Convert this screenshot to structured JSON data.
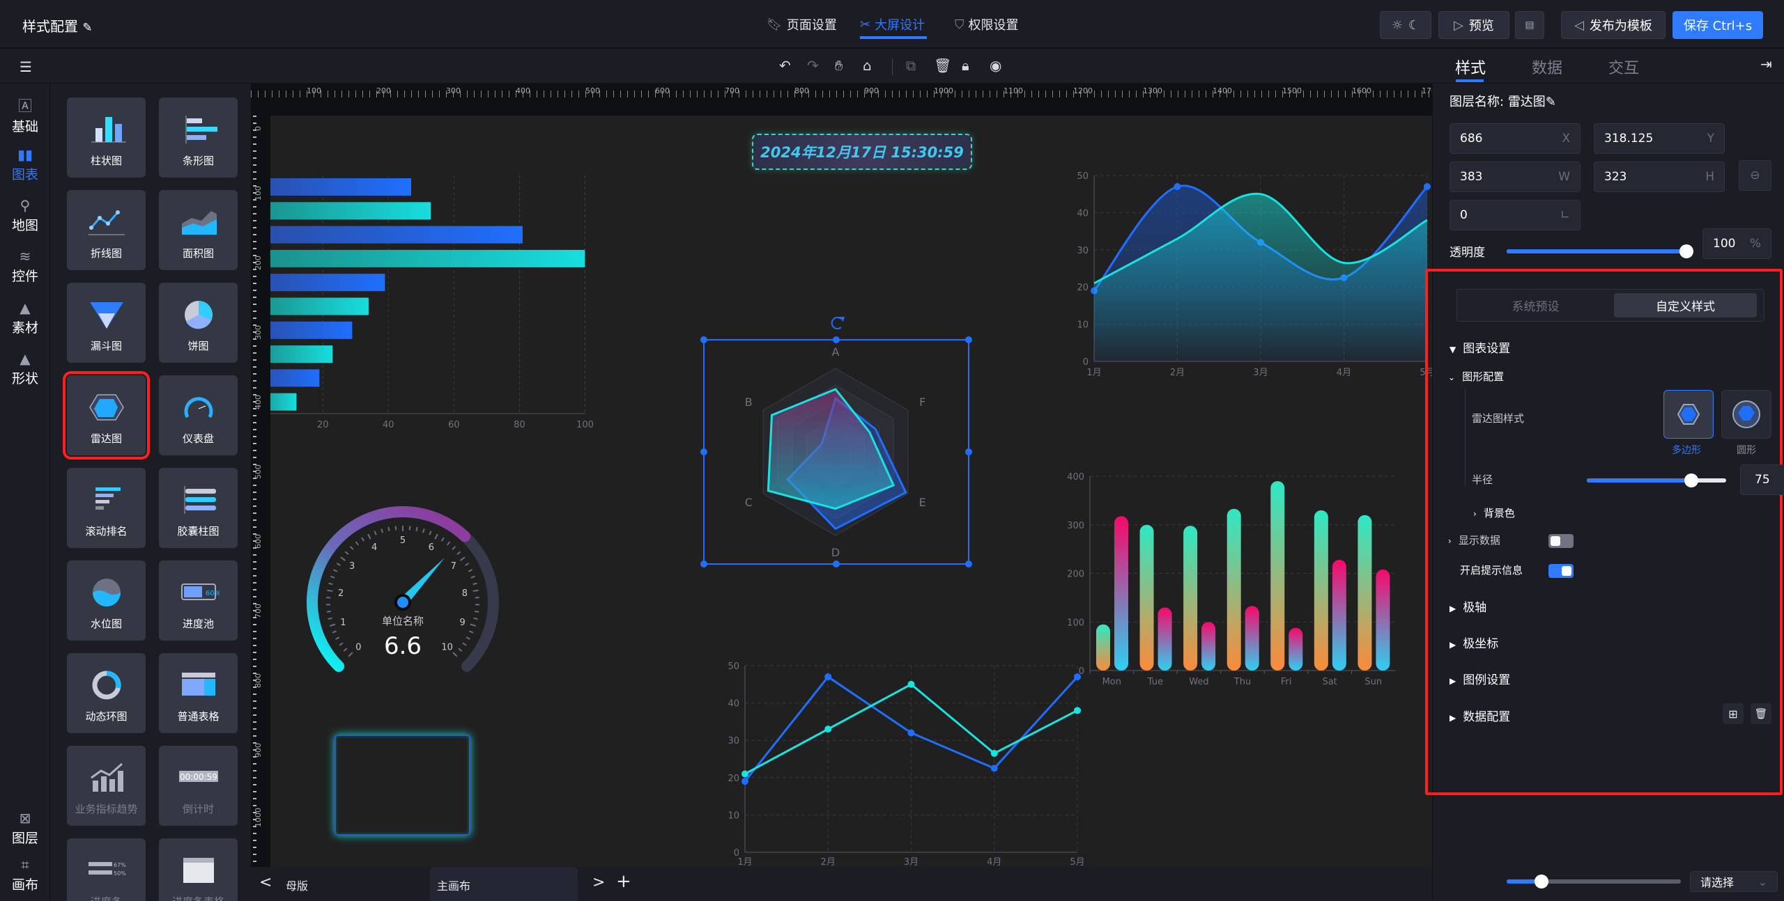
{
  "header": {
    "title": "样式配置",
    "edit_icon": "pencil-icon",
    "tabs": [
      {
        "label": "页面设置",
        "icon": "bookmark-icon"
      },
      {
        "label": "大屏设计",
        "icon": "design-icon",
        "active": true
      },
      {
        "label": "权限设置",
        "icon": "shield-icon"
      }
    ],
    "preview": "预览",
    "publish": "发布为模板",
    "save": "保存 Ctrl+s"
  },
  "toolbar": {
    "icons": [
      "undo-icon",
      "redo-icon",
      "hand-icon",
      "clear-icon",
      "copy-icon",
      "delete-icon",
      "lock-icon",
      "eye-icon"
    ]
  },
  "rail": {
    "items": [
      {
        "label": "基础",
        "icon": "text-box-icon"
      },
      {
        "label": "图表",
        "icon": "bar-chart-icon",
        "active": true
      },
      {
        "label": "地图",
        "icon": "map-pin-icon"
      },
      {
        "label": "控件",
        "icon": "layers-icon"
      },
      {
        "label": "素材",
        "icon": "shapes-icon"
      },
      {
        "label": "形状",
        "icon": "shapes-icon"
      }
    ],
    "bottom": [
      {
        "label": "图层",
        "icon": "layer-icon"
      },
      {
        "label": "画布",
        "icon": "crop-icon"
      }
    ]
  },
  "components": [
    {
      "label": "柱状图",
      "icon": "bar"
    },
    {
      "label": "条形图",
      "icon": "hbar"
    },
    {
      "label": "折线图",
      "icon": "line"
    },
    {
      "label": "面积图",
      "icon": "area"
    },
    {
      "label": "漏斗图",
      "icon": "funnel"
    },
    {
      "label": "饼图",
      "icon": "pie"
    },
    {
      "label": "雷达图",
      "icon": "radar",
      "selected": true
    },
    {
      "label": "仪表盘",
      "icon": "gauge"
    },
    {
      "label": "滚动排名",
      "icon": "rank"
    },
    {
      "label": "胶囊柱图",
      "icon": "capsule"
    },
    {
      "label": "水位图",
      "icon": "water"
    },
    {
      "label": "进度池",
      "icon": "pool",
      "text": "60%"
    },
    {
      "label": "动态环图",
      "icon": "ring"
    },
    {
      "label": "普通表格",
      "icon": "table"
    },
    {
      "label": "业务指标趋势",
      "icon": "trend",
      "disabled": true
    },
    {
      "label": "倒计时",
      "icon": "countdown",
      "text": "00:00:59",
      "disabled": true
    },
    {
      "label": "进度条",
      "icon": "progress",
      "text": [
        "67%",
        "50%"
      ],
      "disabled": true
    },
    {
      "label": "进度条表格",
      "icon": "ptable",
      "disabled": true
    }
  ],
  "rulers": {
    "x": [
      100,
      200,
      300,
      400,
      500,
      600,
      700,
      800,
      900,
      1000,
      1100,
      1200,
      1300,
      1400,
      1500,
      1600,
      1700
    ],
    "y": [
      0,
      100,
      200,
      300,
      400,
      500,
      600,
      700,
      800,
      900,
      1000
    ]
  },
  "canvas": {
    "datetime": "2024年12月17日 15:30:59"
  },
  "chart_data": [
    {
      "type": "bar",
      "orientation": "horizontal",
      "values": [
        47,
        53,
        81,
        100,
        39,
        34,
        29,
        23,
        19,
        12
      ],
      "xticks": [
        20,
        40,
        60,
        80,
        100
      ],
      "colors": [
        "#1f6fff",
        "#17dede"
      ]
    },
    {
      "type": "radar",
      "indicators": [
        "A",
        "F",
        "E",
        "D",
        "C",
        "B"
      ],
      "max": 100,
      "series": [
        {
          "values": [
            64,
            55,
            97,
            92,
            66,
            19
          ],
          "color": "#1f6fff"
        },
        {
          "values": [
            75,
            47,
            80,
            68,
            93,
            88
          ],
          "color": "#17e3e0"
        }
      ]
    },
    {
      "type": "gauge",
      "min": 0,
      "max": 10,
      "value": 6.6,
      "ticks": [
        0,
        1,
        2,
        3,
        4,
        5,
        6,
        7,
        8,
        9,
        10
      ],
      "unit_label": "单位名称",
      "value_label": "6.6"
    },
    {
      "type": "area",
      "categories": [
        "1月",
        "2月",
        "3月",
        "4月",
        "5月"
      ],
      "yticks": [
        0,
        10,
        20,
        30,
        40,
        50
      ],
      "ylim": [
        0,
        50
      ],
      "smooth": true,
      "series": [
        {
          "values": [
            19,
            47,
            32,
            22.5,
            47
          ],
          "color": "#1f6fff"
        },
        {
          "values": [
            21,
            33,
            45,
            26.5,
            38
          ],
          "color": "#17e3e0"
        }
      ]
    },
    {
      "type": "bar",
      "style": "capsule",
      "categories": [
        "Mon",
        "Tue",
        "Wed",
        "Thu",
        "Fri",
        "Sat",
        "Sun"
      ],
      "yticks": [
        0,
        100,
        200,
        300,
        400
      ],
      "ylim": [
        0,
        400
      ],
      "series": [
        {
          "values": [
            95,
            300,
            298,
            333,
            390,
            330,
            320
          ],
          "colors": [
            "#2ee8c4",
            "#fb8a3a"
          ]
        },
        {
          "values": [
            318,
            130,
            100,
            133,
            88,
            228,
            208
          ],
          "colors": [
            "#f7086a",
            "#2ed0f2"
          ]
        }
      ]
    },
    {
      "type": "line",
      "categories": [
        "1月",
        "2月",
        "3月",
        "4月",
        "5月"
      ],
      "yticks": [
        0,
        10,
        20,
        30,
        40,
        50
      ],
      "ylim": [
        0,
        50
      ],
      "series": [
        {
          "values": [
            19,
            47,
            32,
            22.5,
            47
          ],
          "color": "#1f6fff"
        },
        {
          "values": [
            21,
            33,
            45,
            26.5,
            38
          ],
          "color": "#17e3e0"
        }
      ]
    }
  ],
  "bottom": {
    "prev": "<",
    "tabs": [
      "母版",
      "主画布"
    ],
    "next": ">",
    "add": "+"
  },
  "panel": {
    "tabs": [
      "样式",
      "数据",
      "交互"
    ],
    "layer_name_label": "图层名称:",
    "layer_name": "雷达图",
    "x": {
      "value": "686",
      "unit": "X"
    },
    "y": {
      "value": "318.125",
      "unit": "Y"
    },
    "w": {
      "value": "383",
      "unit": "W"
    },
    "h": {
      "value": "323",
      "unit": "H"
    },
    "rotate": {
      "value": "0",
      "unit": "∟"
    },
    "opacity_label": "透明度",
    "opacity": {
      "value": "100",
      "unit": "%",
      "percent": 100
    },
    "mode_tabs": [
      "系统预设",
      "自定义样式"
    ],
    "sections": {
      "chart_settings": "图表设置",
      "shape_config": "图形配置",
      "radar_style_label": "雷达图样式",
      "radar_styles": [
        "多边形",
        "圆形"
      ],
      "radius_label": "半径",
      "radius": {
        "value": "75",
        "percent": 75
      },
      "bg_color": "背景色",
      "show_data": "显示数据",
      "show_data_on": false,
      "tooltip": "开启提示信息",
      "tooltip_on": true,
      "polar_axis": "极轴",
      "polar_coord": "极坐标",
      "legend": "图例设置",
      "data_config": "数据配置"
    },
    "zoom_percent": 20,
    "select_placeholder": "请选择",
    "accent": "#2f7bff",
    "highlight": "#ff1f1f"
  }
}
